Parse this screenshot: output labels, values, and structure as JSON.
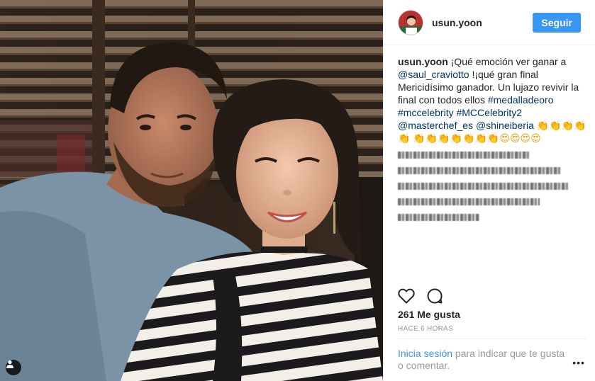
{
  "header": {
    "username": "usun.yoon",
    "follow_label": "Seguir"
  },
  "caption": {
    "username": "usun.yoon",
    "text1": " ¡Qué emoción ver ganar a ",
    "mention1": "@saul_craviotto",
    "text2": " !¡qué gran final Mericidísimo ganador. Un lujazo revivir la final con todos ellos ",
    "hashtag1": "#medalladeoro",
    "hashtag2": "#mccelebrity",
    "hashtag3": "#MCCelebrity2",
    "mention2": "@masterchef_es",
    "mention3": "@shineiberia",
    "emojis1": "👏👏👏👏👏",
    "emojis2": "👏👏👏👏👏👏👏😍😍😍😍"
  },
  "stats": {
    "likes": "261 Me gusta",
    "time_ago": "HACE 6 HORAS"
  },
  "login_prompt": {
    "link": "Inicia sesión",
    "text": " para indicar que te gusta o comentar."
  },
  "more_label": "•••",
  "icons": {
    "like": "heart-icon",
    "comment": "comment-icon",
    "tagged": "user-tag-icon",
    "more": "more-options-icon"
  },
  "colors": {
    "follow_button": "#3897f0",
    "link": "#003569",
    "login_link": "#3897f0"
  }
}
